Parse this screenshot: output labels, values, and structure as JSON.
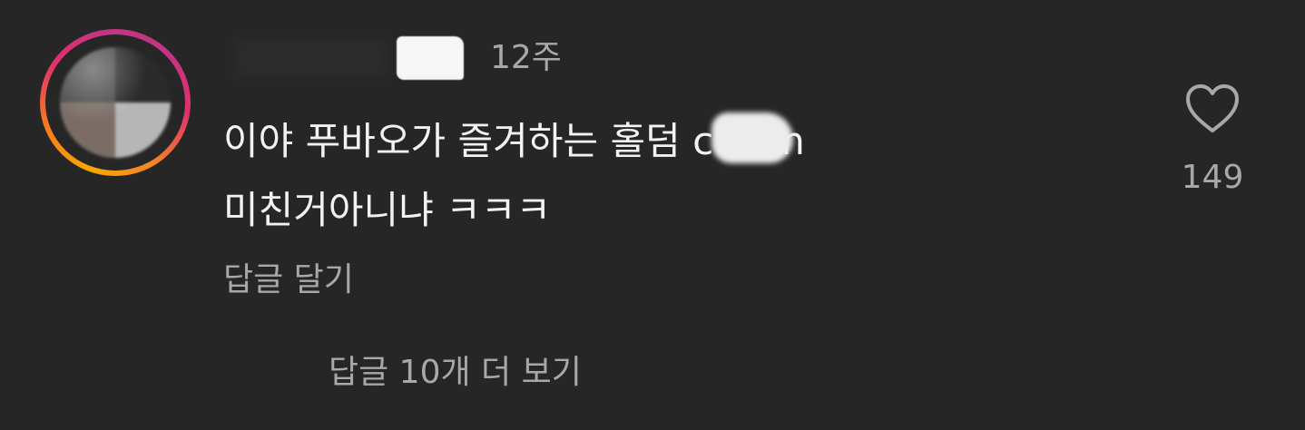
{
  "comment": {
    "avatar": {
      "icon": "profile-picture"
    },
    "timestamp": "12주",
    "text_line1": "이야 푸바오가 즐겨하는 홀덤 c O m",
    "text_line2": "미친거아니냐 ㅋㅋㅋ",
    "reply_label": "답글 달기",
    "view_replies_label": "답글 10개 더 보기",
    "like_count": "149",
    "like_icon": "heart-outline-icon"
  },
  "colors": {
    "background": "#262626",
    "text_primary": "#f2f2f2",
    "text_secondary": "#a8a8a8",
    "story_ring_start": "#f7a800",
    "story_ring_end": "#c13584"
  }
}
